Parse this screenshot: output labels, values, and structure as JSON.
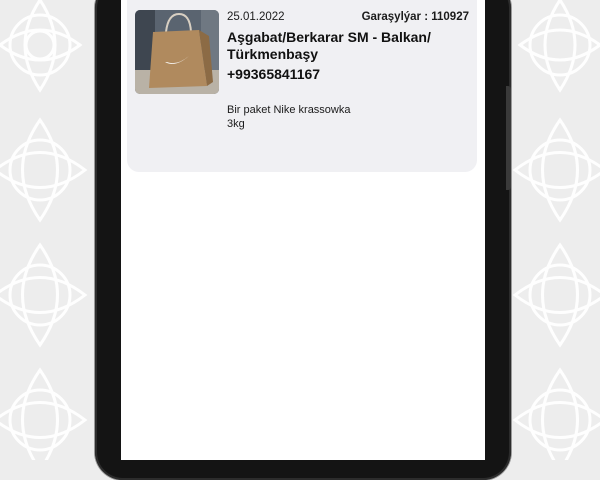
{
  "shipment": {
    "date": "25.01.2022",
    "tracking": "Garaşylýar : 110927",
    "route": "Aşgabat/Berkarar SM - Balkan/ Türkmenbaşy",
    "phone": "+99365841167",
    "description_line1": "Bir paket Nike krassowka",
    "description_line2": "3kg",
    "thumbnail": "nike-paper-bag-photo"
  },
  "colors": {
    "card_background": "#f0f0f3",
    "screen_background": "#ffffff",
    "phone_frame": "#141414"
  }
}
